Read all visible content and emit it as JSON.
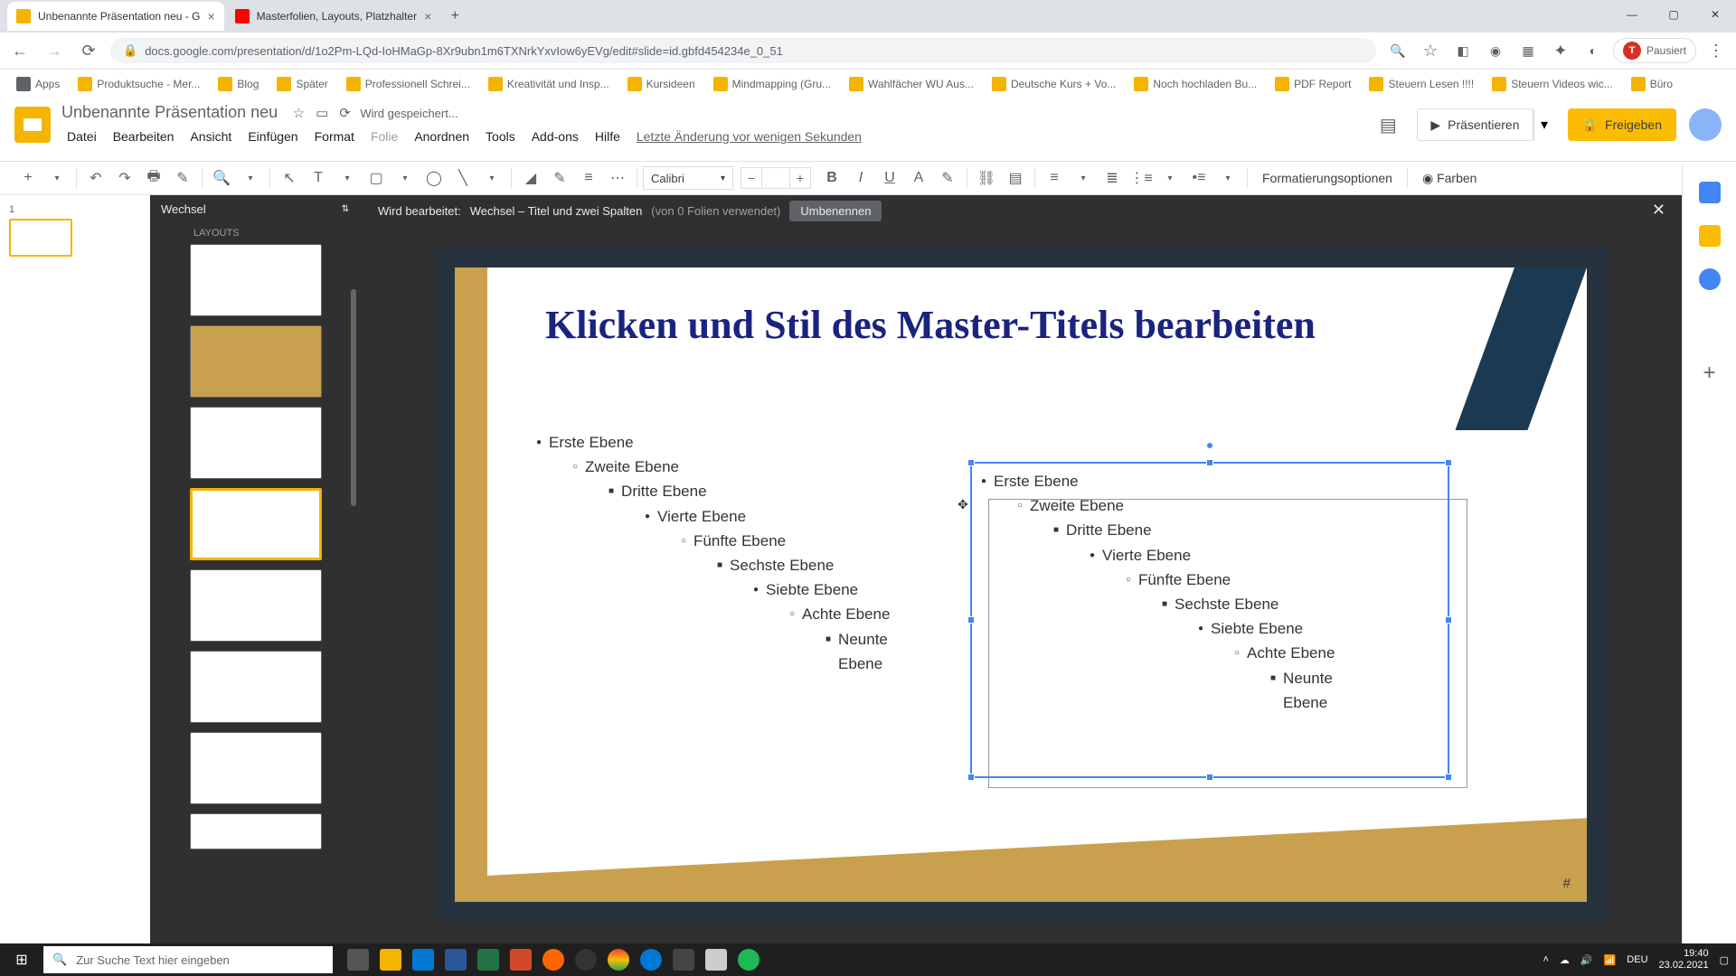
{
  "browser": {
    "tabs": [
      {
        "title": "Unbenannte Präsentation neu - G",
        "favicon": "slides"
      },
      {
        "title": "Masterfolien, Layouts, Platzhalter",
        "favicon": "yt"
      }
    ],
    "url": "docs.google.com/presentation/d/1o2Pm-LQd-IoHMaGp-8Xr9ubn1m6TXNrkYxvIow6yEVg/edit#slide=id.gbfd454234e_0_51",
    "profile_label": "Pausiert",
    "profile_initial": "T",
    "bookmarks": [
      "Apps",
      "Produktsuche - Mer...",
      "Blog",
      "Später",
      "Professionell Schrei...",
      "Kreativität und Insp...",
      "Kursideen",
      "Mindmapping (Gru...",
      "Wahlfächer WU Aus...",
      "Deutsche Kurs + Vo...",
      "Noch hochladen Bu...",
      "PDF Report",
      "Steuern Lesen !!!!",
      "Steuern Videos wic...",
      "Büro"
    ]
  },
  "app": {
    "doc_title": "Unbenannte Präsentation neu",
    "save_status": "Wird gespeichert...",
    "menus": [
      "Datei",
      "Bearbeiten",
      "Ansicht",
      "Einfügen",
      "Format",
      "Folie",
      "Anordnen",
      "Tools",
      "Add-ons",
      "Hilfe"
    ],
    "last_edit": "Letzte Änderung vor wenigen Sekunden",
    "present_label": "Präsentieren",
    "share_label": "Freigeben"
  },
  "toolbar": {
    "font": "Calibri",
    "format_options": "Formatierungsoptionen",
    "themes": "Farben"
  },
  "master": {
    "theme_name": "Wechsel",
    "layouts_heading": "LAYOUTS",
    "edit_prefix": "Wird bearbeitet:",
    "edit_layout": "Wechsel – Titel und zwei Spalten",
    "edit_usage": "(von 0 Folien verwendet)",
    "rename": "Umbenennen"
  },
  "slide": {
    "title": "Klicken und Stil des Master-Titels bearbeiten",
    "levels": [
      "Erste Ebene",
      "Zweite Ebene",
      "Dritte Ebene",
      "Vierte Ebene",
      "Fünfte Ebene",
      "Sechste Ebene",
      "Siebte Ebene",
      "Achte Ebene",
      "Neunte Ebene"
    ],
    "page_num": "#"
  },
  "taskbar": {
    "search_placeholder": "Zur Suche Text hier eingeben",
    "lang": "DEU",
    "time": "19:40",
    "date": "23.02.2021"
  }
}
